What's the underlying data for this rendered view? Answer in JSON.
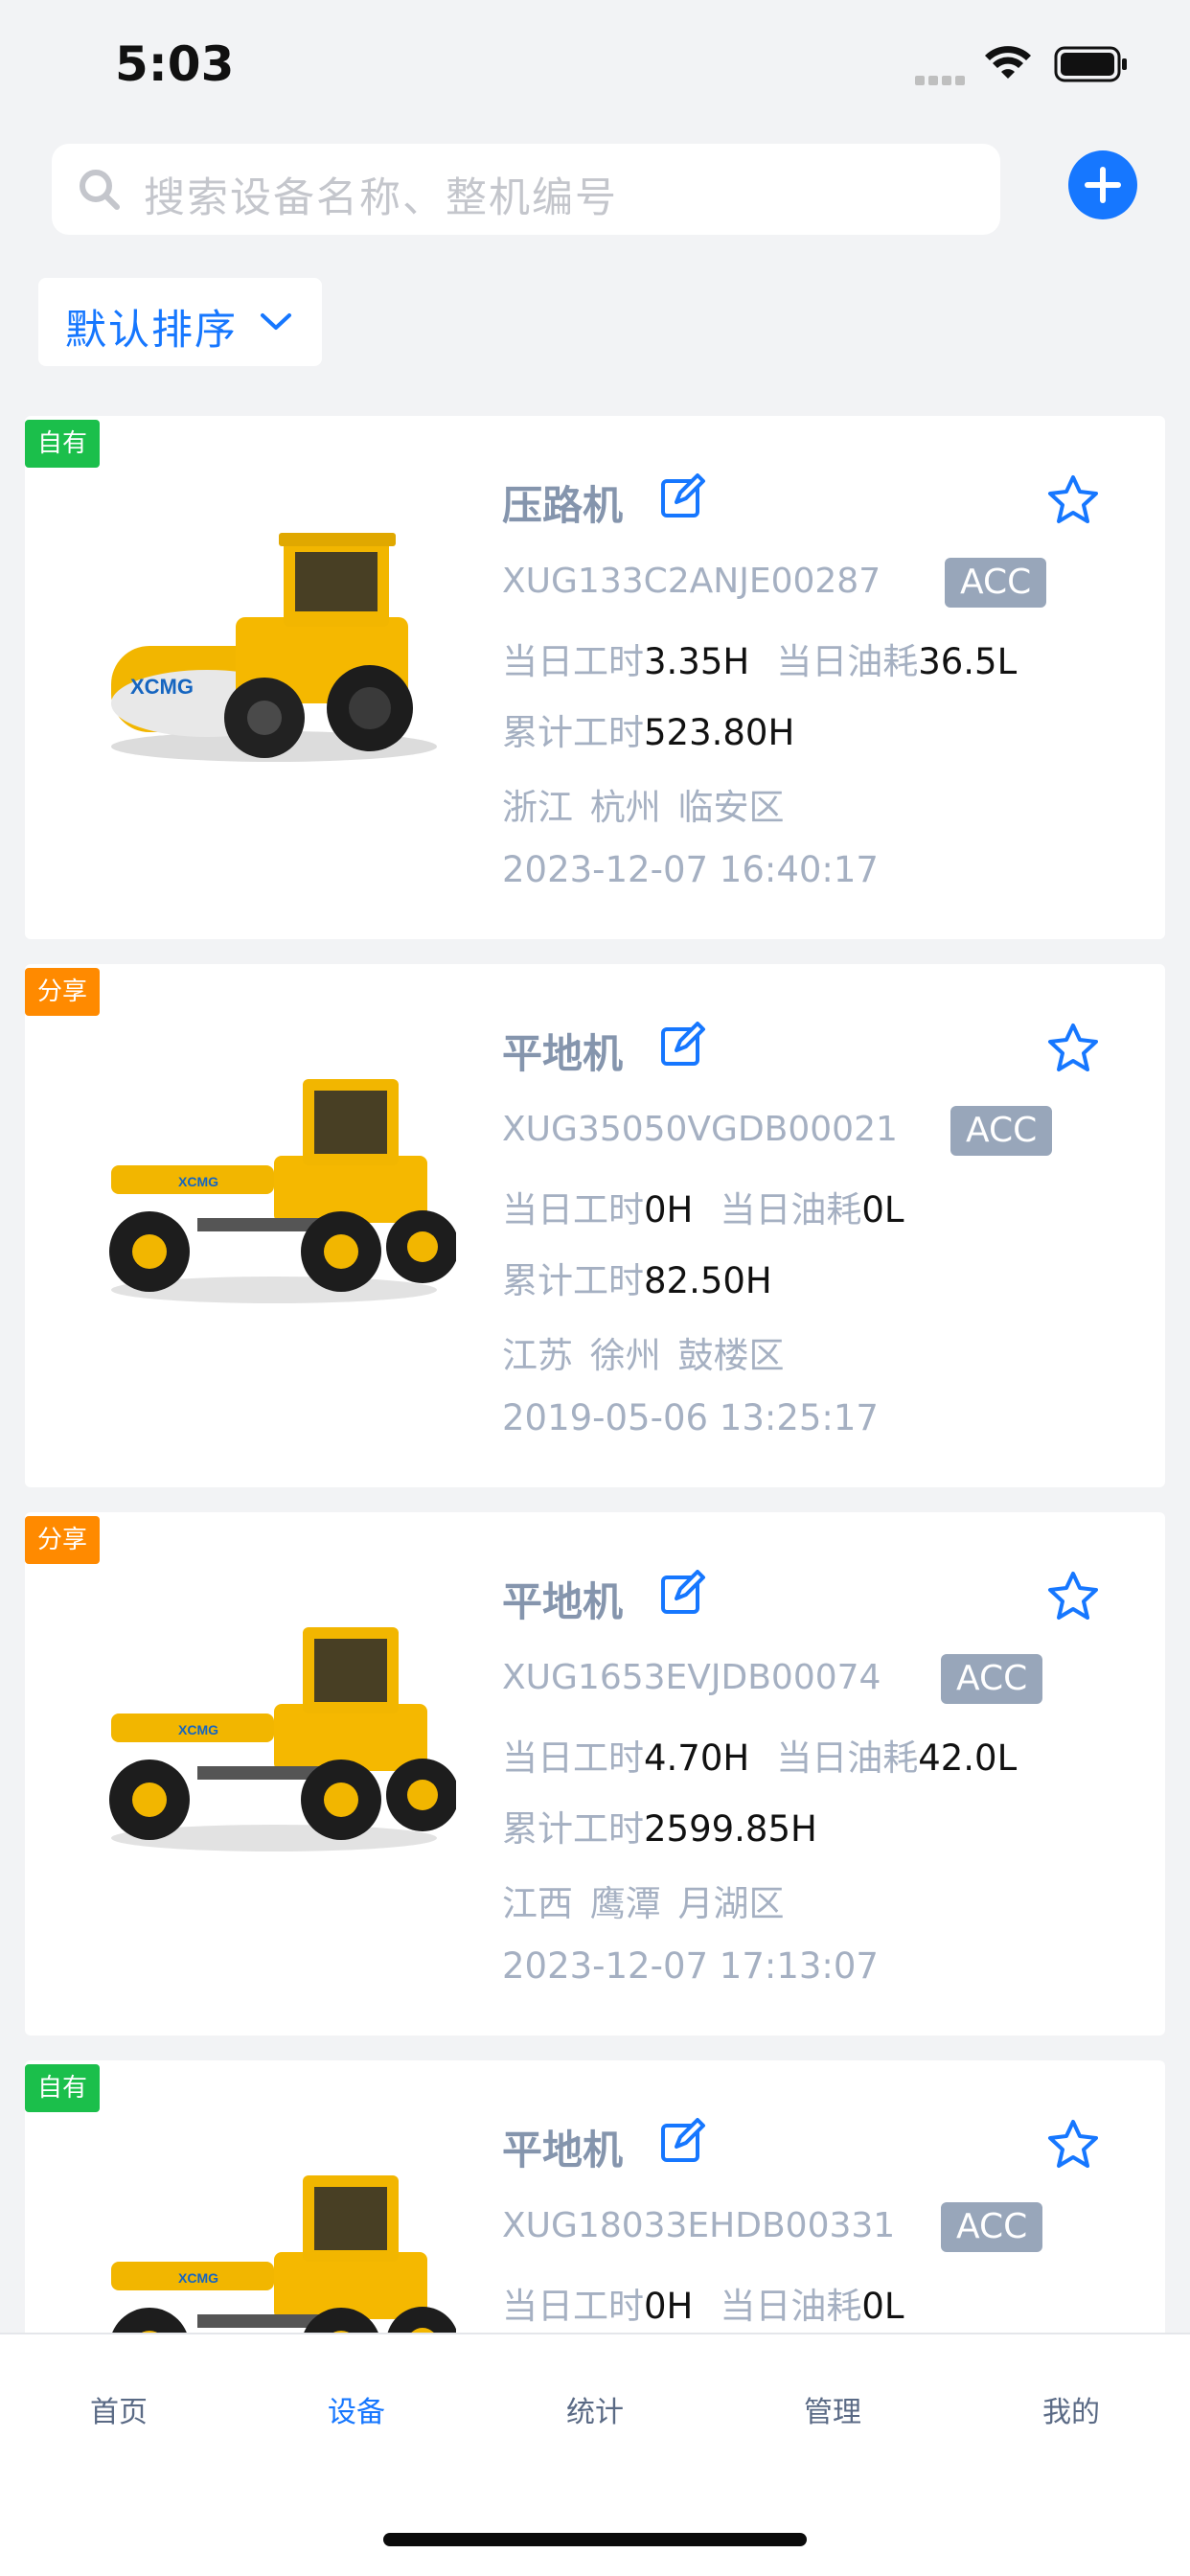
{
  "status_bar": {
    "time": "5:03"
  },
  "search": {
    "placeholder": "搜索设备名称、整机编号"
  },
  "sort": {
    "label": "默认排序"
  },
  "colors": {
    "accent": "#1677ff",
    "tag_own": "#1bbf4b",
    "tag_share": "#ff8a00",
    "acc_badge": "#98a6ba"
  },
  "labels": {
    "daily_hours": "当日工时",
    "daily_fuel": "当日油耗",
    "total_hours": "累计工时"
  },
  "devices": [
    {
      "tag": "自有",
      "name": "压路机",
      "serial": "XUG133C2ANJE00287",
      "acc": "ACC",
      "daily_hours": "3.35H",
      "daily_fuel": "36.5L",
      "total_hours": "523.80H",
      "region": "浙江 杭州 临安区",
      "timestamp": "2023-12-07 16:40:17",
      "image": "road-roller-icon"
    },
    {
      "tag": "分享",
      "name": "平地机",
      "serial": "XUG35050VGDB00021",
      "acc": "ACC",
      "daily_hours": "0H",
      "daily_fuel": "0L",
      "total_hours": "82.50H",
      "region": "江苏 徐州 鼓楼区",
      "timestamp": "2019-05-06 13:25:17",
      "image": "motor-grader-icon"
    },
    {
      "tag": "分享",
      "name": "平地机",
      "serial": "XUG1653EVJDB00074",
      "acc": "ACC",
      "daily_hours": "4.70H",
      "daily_fuel": "42.0L",
      "total_hours": "2599.85H",
      "region": "江西 鹰潭 月湖区",
      "timestamp": "2023-12-07 17:13:07",
      "image": "motor-grader-icon"
    },
    {
      "tag": "自有",
      "name": "平地机",
      "serial": "XUG18033EHDB00331",
      "acc": "ACC",
      "daily_hours": "0H",
      "daily_fuel": "0L",
      "image": "motor-grader-icon"
    }
  ],
  "tabs": [
    {
      "label": "首页",
      "active": false
    },
    {
      "label": "设备",
      "active": true
    },
    {
      "label": "统计",
      "active": false
    },
    {
      "label": "管理",
      "active": false
    },
    {
      "label": "我的",
      "active": false
    }
  ]
}
